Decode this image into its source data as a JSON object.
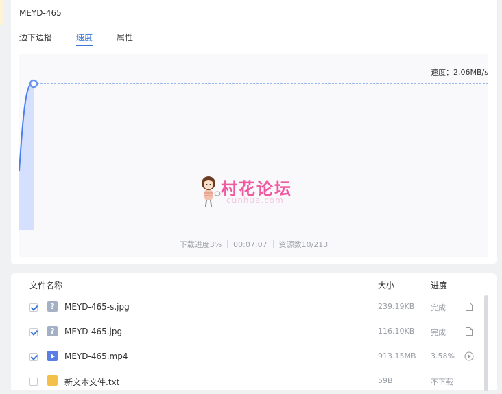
{
  "task": {
    "title": "MEYD-465"
  },
  "tabs": [
    {
      "label": "边下边播",
      "active": false
    },
    {
      "label": "速度",
      "active": true
    },
    {
      "label": "属性",
      "active": false
    }
  ],
  "speed_chart": {
    "speed_label": "速度：2.06MB/s",
    "colors": {
      "line": "#4a7ff0",
      "fill": "#cfdcff",
      "dash": "#3c78d8"
    }
  },
  "stats": {
    "progress": "下载进度3%",
    "time": "00:07:07",
    "sources": "资源数10/213"
  },
  "watermark": {
    "text": "村花论坛",
    "sub": "cunhua.com"
  },
  "file_list": {
    "headers": {
      "name": "文件名称",
      "size": "大小",
      "progress": "进度"
    },
    "rows": [
      {
        "checked": true,
        "icon": "unknown-file-icon",
        "name": "MEYD-465-s.jpg",
        "size": "239.19KB",
        "progress": "完成",
        "action": "open-file-icon"
      },
      {
        "checked": true,
        "icon": "unknown-file-icon",
        "name": "MEYD-465.jpg",
        "size": "116.10KB",
        "progress": "完成",
        "action": "open-file-icon"
      },
      {
        "checked": true,
        "icon": "video-file-icon",
        "name": "MEYD-465.mp4",
        "size": "913.15MB",
        "progress": "3.58%",
        "action": "play-icon"
      },
      {
        "checked": false,
        "icon": "text-file-icon",
        "name": "新文本文件.txt",
        "size": "59B",
        "progress": "不下载",
        "action": ""
      }
    ]
  }
}
